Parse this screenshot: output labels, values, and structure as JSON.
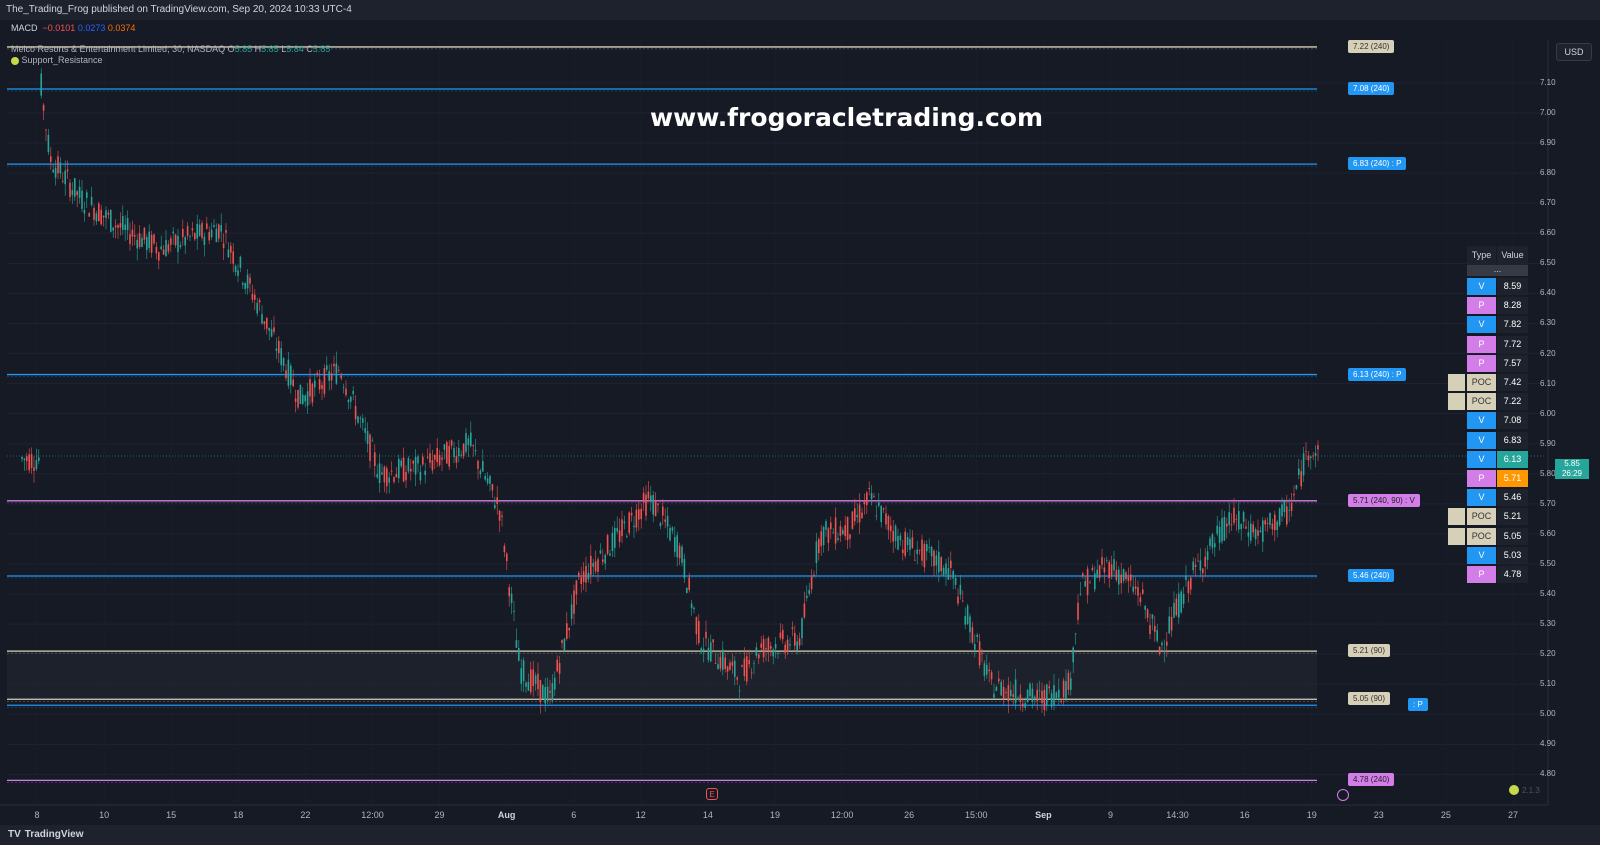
{
  "header": {
    "publisher_line": "The_Trading_Frog published on TradingView.com, Sep 20, 2024 10:33 UTC-4"
  },
  "macd": {
    "label": "MACD",
    "v1": "−0.0101",
    "v2": "0.0273",
    "v3": "0.0374"
  },
  "symbol": {
    "name": "Melco Resorts & Entertainment Limited, 30, NASDAQ",
    "open_label": "O",
    "open": "5.85",
    "high_label": "H",
    "high": "5.85",
    "low_label": "L",
    "low": "5.84",
    "close_label": "C",
    "close": "5.85",
    "indicator": "Support_Resistance"
  },
  "watermark": "www.frogoracletrading.com",
  "currency_button": "USD",
  "current_price": {
    "value": "5.85",
    "countdown": "26:29",
    "color": "#26a69a"
  },
  "price_axis": [
    "7.10",
    "7.00",
    "6.90",
    "6.80",
    "6.70",
    "6.60",
    "6.50",
    "6.40",
    "6.30",
    "6.20",
    "6.10",
    "6.00",
    "5.90",
    "5.80",
    "5.70",
    "5.60",
    "5.50",
    "5.40",
    "5.30",
    "5.20",
    "5.10",
    "5.00",
    "4.90",
    "4.80"
  ],
  "time_axis": [
    {
      "label": "8",
      "bold": false
    },
    {
      "label": "10",
      "bold": false
    },
    {
      "label": "15",
      "bold": false
    },
    {
      "label": "18",
      "bold": false
    },
    {
      "label": "22",
      "bold": false
    },
    {
      "label": "12:00",
      "bold": false
    },
    {
      "label": "29",
      "bold": false
    },
    {
      "label": "Aug",
      "bold": true
    },
    {
      "label": "6",
      "bold": false
    },
    {
      "label": "12",
      "bold": false
    },
    {
      "label": "14",
      "bold": false
    },
    {
      "label": "19",
      "bold": false
    },
    {
      "label": "12:00",
      "bold": false
    },
    {
      "label": "26",
      "bold": false
    },
    {
      "label": "15:00",
      "bold": false
    },
    {
      "label": "Sep",
      "bold": true
    },
    {
      "label": "9",
      "bold": false
    },
    {
      "label": "14:30",
      "bold": false
    },
    {
      "label": "16",
      "bold": false
    },
    {
      "label": "19",
      "bold": false
    },
    {
      "label": "23",
      "bold": false
    },
    {
      "label": "25",
      "bold": false
    },
    {
      "label": "27",
      "bold": false
    }
  ],
  "sr_levels": [
    {
      "label": "7.22 (240)",
      "style": "tan",
      "price": 7.22
    },
    {
      "label": "7.08 (240)",
      "style": "blue",
      "price": 7.08
    },
    {
      "label": "6.83 (240) : P",
      "style": "blue",
      "price": 6.83
    },
    {
      "label": "6.13 (240) : P",
      "style": "blue",
      "price": 6.13
    },
    {
      "label": "5.71 (240, 90) : V",
      "style": "pink",
      "price": 5.71
    },
    {
      "label": "5.46 (240)",
      "style": "blue",
      "price": 5.46
    },
    {
      "label": "5.21 (90)",
      "style": "tan",
      "price": 5.21
    },
    {
      "label": "5.05 (90)",
      "style": "tan",
      "price": 5.05
    },
    {
      "label": ": P",
      "style": "blue",
      "price": 5.03
    },
    {
      "label": "4.78 (240)",
      "style": "pink",
      "price": 4.78
    }
  ],
  "sr_table": {
    "header_type": "Type",
    "header_value": "Value",
    "divider": "...",
    "rows": [
      {
        "type": "V",
        "value": "8.59",
        "poc": false,
        "highlight": ""
      },
      {
        "type": "P",
        "value": "8.28",
        "poc": false,
        "highlight": ""
      },
      {
        "type": "V",
        "value": "7.82",
        "poc": false,
        "highlight": ""
      },
      {
        "type": "P",
        "value": "7.72",
        "poc": false,
        "highlight": ""
      },
      {
        "type": "P",
        "value": "7.57",
        "poc": false,
        "highlight": ""
      },
      {
        "type": "POC",
        "value": "7.42",
        "poc": true,
        "highlight": ""
      },
      {
        "type": "POC",
        "value": "7.22",
        "poc": true,
        "highlight": ""
      },
      {
        "type": "V",
        "value": "7.08",
        "poc": false,
        "highlight": ""
      },
      {
        "type": "V",
        "value": "6.83",
        "poc": false,
        "highlight": ""
      },
      {
        "type": "V",
        "value": "6.13",
        "poc": false,
        "highlight": "#26a69a"
      },
      {
        "type": "P",
        "value": "5.71",
        "poc": false,
        "highlight": "#ff9800"
      },
      {
        "type": "V",
        "value": "5.46",
        "poc": false,
        "highlight": ""
      },
      {
        "type": "POC",
        "value": "5.21",
        "poc": true,
        "highlight": ""
      },
      {
        "type": "POC",
        "value": "5.05",
        "poc": true,
        "highlight": ""
      },
      {
        "type": "V",
        "value": "5.03",
        "poc": false,
        "highlight": ""
      },
      {
        "type": "P",
        "value": "4.78",
        "poc": false,
        "highlight": ""
      }
    ]
  },
  "colors": {
    "up": "#26a69a",
    "down": "#ef5350",
    "blue": "#2196f3",
    "tan": "#d6d0b8",
    "pink": "#d37ee8"
  },
  "footer": {
    "brand": "TradingView",
    "version": "2.1.3"
  },
  "icons": {
    "event": "earnings-icon",
    "frog": "frog-icon"
  }
}
